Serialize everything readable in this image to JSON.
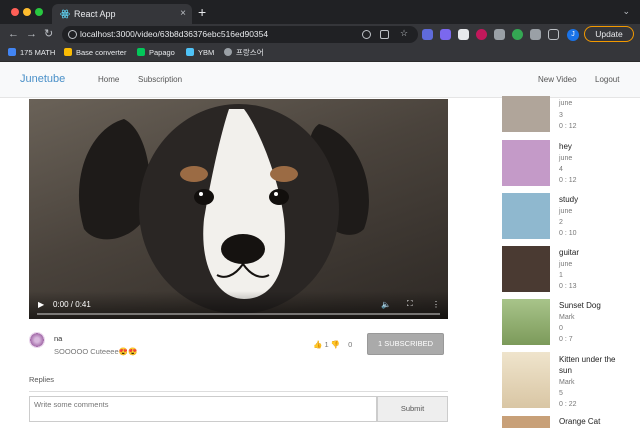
{
  "browser": {
    "tab_title": "React App",
    "tab_close": "×",
    "new_tab": "+",
    "url": "localhost:3000/video/63b8d36376ebc516ed90354",
    "update_label": "Update",
    "profile_initial": "J",
    "bookmarks": [
      {
        "label": "175 MATH",
        "color": "#4285f4"
      },
      {
        "label": "Base converter",
        "color": "#fbbc04"
      },
      {
        "label": "Papago",
        "color": "#03c75a"
      },
      {
        "label": "YBM",
        "color": "#4fc3f7"
      },
      {
        "label": "프랑스어",
        "color": "#9aa0a6"
      }
    ]
  },
  "navbar": {
    "brand": "Junetube",
    "home": "Home",
    "subscription": "Subscription",
    "new_video": "New Video",
    "logout": "Logout"
  },
  "video": {
    "time": "0:00 / 0:41"
  },
  "uploader": {
    "name": "na",
    "description": "SOOOOO Cuteeee😍😍"
  },
  "likes": {
    "like_count": "1",
    "dislike_count": "0"
  },
  "subscribe_label": "1 SUBSCRIBED",
  "comments": {
    "replies_label": "Replies",
    "placeholder": "Write some comments",
    "submit_label": "Submit"
  },
  "sidebar": {
    "items": [
      {
        "title": "",
        "author": "june",
        "views": "3",
        "duration": "0 : 12",
        "thumb": "#b0a59a"
      },
      {
        "title": "hey",
        "author": "june",
        "views": "4",
        "duration": "0 : 12",
        "thumb": "#c49ac8"
      },
      {
        "title": "study",
        "author": "june",
        "views": "2",
        "duration": "0 : 10",
        "thumb": "#8fb8cf"
      },
      {
        "title": "guitar",
        "author": "june",
        "views": "1",
        "duration": "0 : 13",
        "thumb": "#4a3a32"
      },
      {
        "title": "Sunset Dog",
        "author": "Mark",
        "views": "0",
        "duration": "0 : 7",
        "thumb": "#7c9a5a"
      },
      {
        "title": "Kitten under the sun",
        "author": "Mark",
        "views": "5",
        "duration": "0 : 22",
        "thumb": "#d9c6a4"
      },
      {
        "title": "Orange Cat",
        "author": "",
        "views": "",
        "duration": "",
        "thumb": "#c8a078"
      }
    ]
  }
}
